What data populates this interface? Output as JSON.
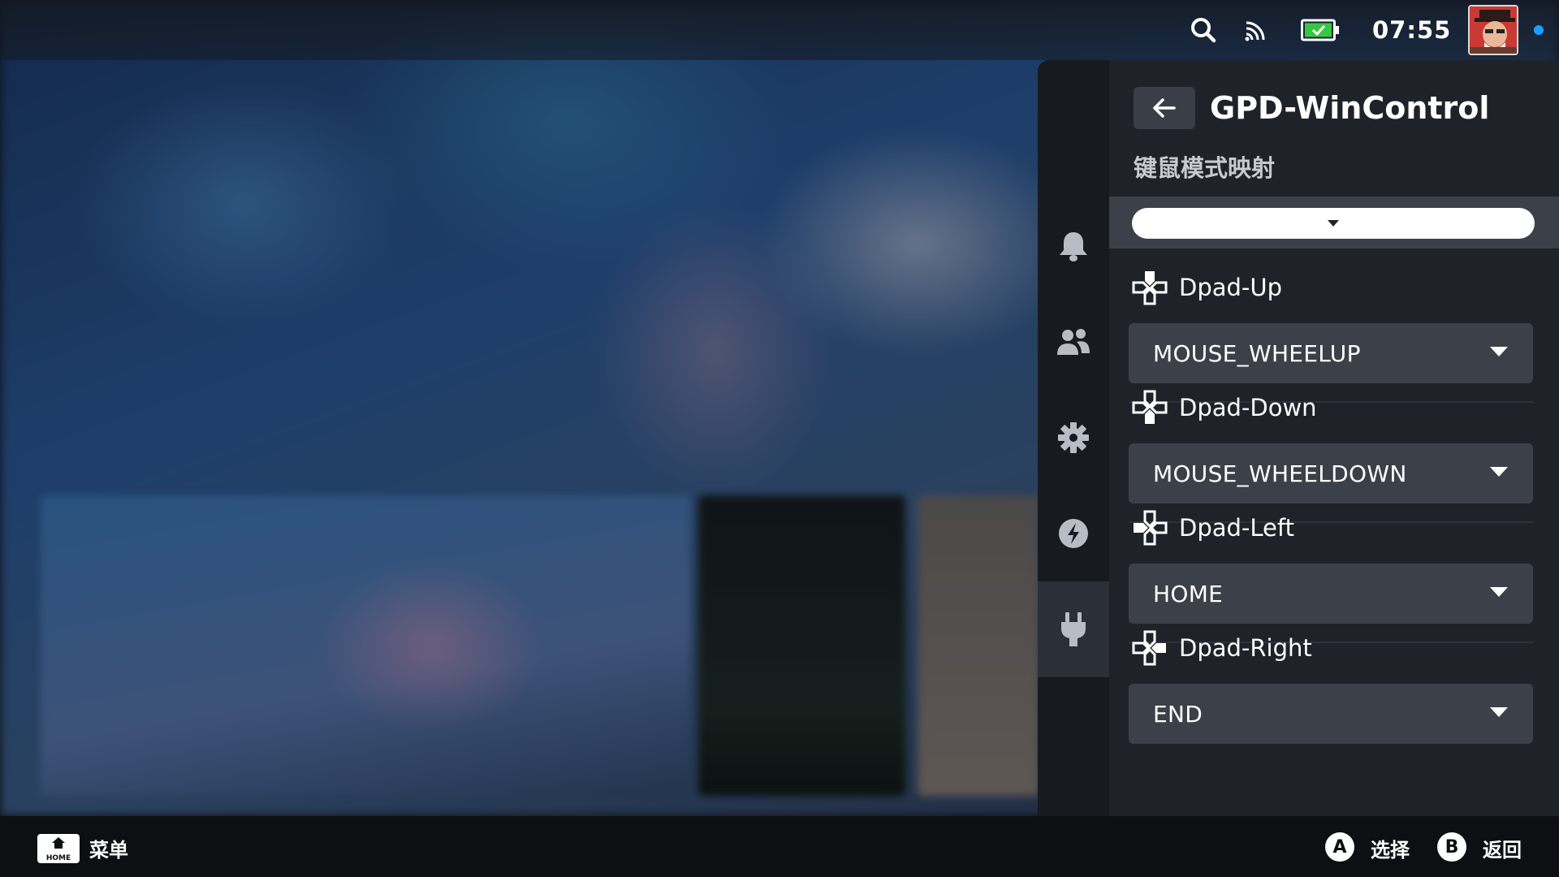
{
  "status_bar": {
    "time": "07:55",
    "icons": [
      "search-icon",
      "cast-icon",
      "battery-charging-icon"
    ],
    "battery_color": "#36c940",
    "online_dot_color": "#1a9fff"
  },
  "quick_access": {
    "rail": [
      "bell-icon",
      "friends-icon",
      "gear-icon",
      "lightning-icon",
      "plug-icon"
    ],
    "active_rail": "plug-icon",
    "plugin_title": "GPD-WinControl",
    "section_label": "键鼠模式映射",
    "profile_selected": "",
    "mappings": [
      {
        "label": "Dpad-Up",
        "value": "MOUSE_WHEELUP"
      },
      {
        "label": "Dpad-Down",
        "value": "MOUSE_WHEELDOWN"
      },
      {
        "label": "Dpad-Left",
        "value": "HOME"
      },
      {
        "label": "Dpad-Right",
        "value": "END"
      }
    ]
  },
  "bottom_bar": {
    "home_badge": "HOME",
    "menu_label": "菜单",
    "a_button": "A",
    "a_label": "选择",
    "b_button": "B",
    "b_label": "返回"
  }
}
